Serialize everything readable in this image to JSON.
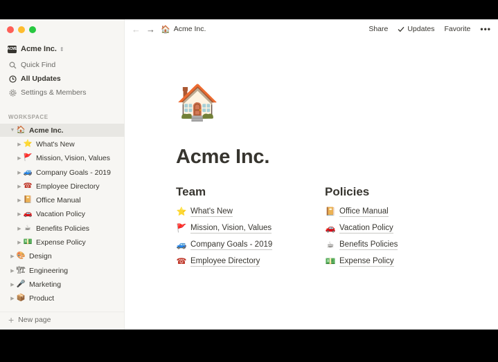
{
  "workspace": {
    "name": "Acme Inc.",
    "logo_text": "ACME"
  },
  "sidebar": {
    "nav": [
      {
        "label": "Quick Find",
        "icon": "search-icon"
      },
      {
        "label": "All Updates",
        "icon": "clock-icon"
      },
      {
        "label": "Settings & Members",
        "icon": "gear-icon"
      }
    ],
    "section_label": "WORKSPACE",
    "tree": [
      {
        "emoji": "🏠",
        "label": "Acme Inc."
      },
      {
        "emoji": "⭐",
        "label": "What's New"
      },
      {
        "emoji": "🚩",
        "label": "Mission, Vision, Values"
      },
      {
        "emoji": "🚙",
        "label": "Company Goals - 2019"
      },
      {
        "emoji": "☎",
        "label": "Employee Directory"
      },
      {
        "emoji": "📔",
        "label": "Office Manual"
      },
      {
        "emoji": "🚗",
        "label": "Vacation Policy"
      },
      {
        "emoji": "☕",
        "label": "Benefits Policies"
      },
      {
        "emoji": "💵",
        "label": "Expense Policy"
      },
      {
        "emoji": "🎨",
        "label": "Design"
      },
      {
        "emoji": "🏗",
        "label": "Engineering"
      },
      {
        "emoji": "🎤",
        "label": "Marketing"
      },
      {
        "emoji": "📦",
        "label": "Product"
      }
    ],
    "new_page": "New page"
  },
  "topbar": {
    "crumb_emoji": "🏠",
    "crumb": "Acme Inc.",
    "share": "Share",
    "updates": "Updates",
    "favorite": "Favorite",
    "more": "•••"
  },
  "page": {
    "icon": "🏠",
    "title": "Acme Inc.",
    "team": {
      "heading": "Team",
      "links": [
        {
          "emoji": "⭐",
          "label": "What's New"
        },
        {
          "emoji": "🚩",
          "label": "Mission, Vision, Values"
        },
        {
          "emoji": "🚙",
          "label": "Company Goals - 2019"
        },
        {
          "emoji": "☎",
          "label": "Employee Directory"
        }
      ]
    },
    "policies": {
      "heading": "Policies",
      "links": [
        {
          "emoji": "📔",
          "label": "Office Manual"
        },
        {
          "emoji": "🚗",
          "label": "Vacation Policy"
        },
        {
          "emoji": "☕",
          "label": "Benefits Policies"
        },
        {
          "emoji": "💵",
          "label": "Expense Policy"
        }
      ]
    }
  }
}
